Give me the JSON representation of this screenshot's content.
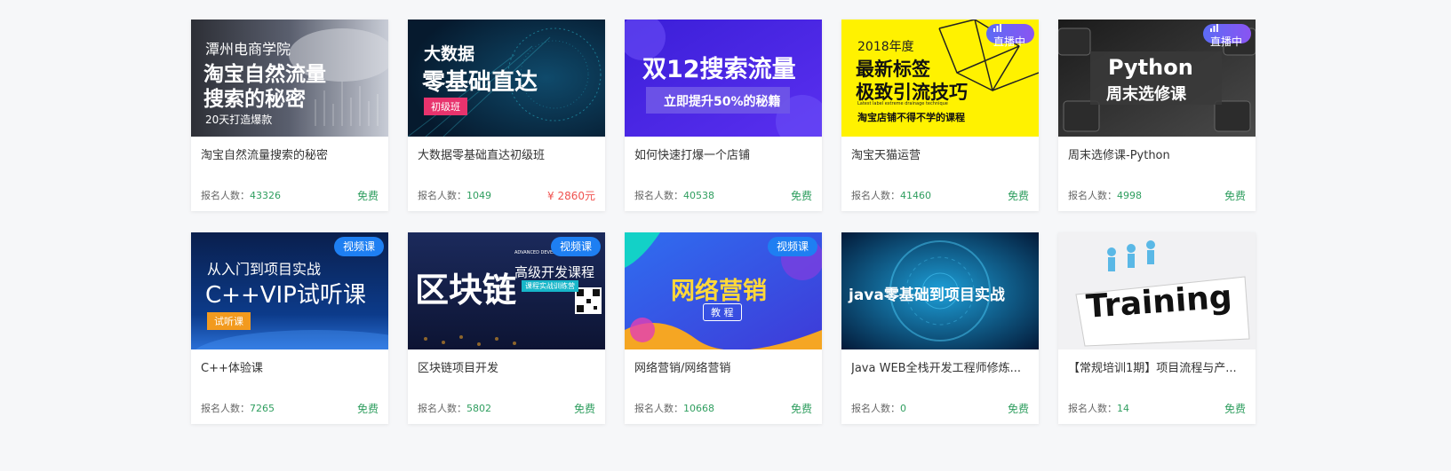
{
  "enroll_label": "报名人数：",
  "colors": {
    "free": "#2f9e5f",
    "paid": "#f0524f",
    "live_badge": "#6b5ff3",
    "video_badge": "#1e7ff2"
  },
  "courses": [
    {
      "title": "淘宝自然流量搜索的秘密",
      "enroll_count": "43326",
      "price": "免费",
      "badge": "",
      "cover_text": [
        "潭州电商学院",
        "淘宝自然流量",
        "搜索的秘密",
        "20天打造爆款"
      ]
    },
    {
      "title": "大数据零基础直达初级班",
      "enroll_count": "1049",
      "price": "¥ 2860元",
      "badge": "",
      "cover_text": [
        "大数据",
        "零基础直达",
        "初级班"
      ]
    },
    {
      "title": "如何快速打爆一个店铺",
      "enroll_count": "40538",
      "price": "免费",
      "badge": "",
      "cover_text": [
        "双12搜索流量",
        "立即提升50%的秘籍"
      ]
    },
    {
      "title": "淘宝天猫运营",
      "enroll_count": "41460",
      "price": "免费",
      "badge": "直播中",
      "cover_text": [
        "2018年度",
        "最新标签",
        "极致引流技巧",
        "Latest label extreme drainage technique",
        "淘宝店铺不得不学的课程"
      ]
    },
    {
      "title": "周末选修课-Python",
      "enroll_count": "4998",
      "price": "免费",
      "badge": "直播中",
      "cover_text": [
        "Python",
        "周末选修课"
      ]
    },
    {
      "title": "C++体验课",
      "enroll_count": "7265",
      "price": "免费",
      "badge": "视频课",
      "cover_text": [
        "从入门到项目实战",
        "C++VIP试听课",
        "试听课"
      ]
    },
    {
      "title": "区块链项目开发",
      "enroll_count": "5802",
      "price": "免费",
      "badge": "视频课",
      "cover_text": [
        "区块链",
        "高级开发课程",
        "ADVANCED DEVELOPMENT COURSE",
        "课程实战训练营"
      ]
    },
    {
      "title": "网络营销/网络营销",
      "enroll_count": "10668",
      "price": "免费",
      "badge": "视频课",
      "cover_text": [
        "网络营销",
        "教 程"
      ]
    },
    {
      "title": "Java WEB全栈开发工程师修炼...",
      "enroll_count": "0",
      "price": "免费",
      "badge": "",
      "cover_text": [
        "java零基础到项目实战"
      ]
    },
    {
      "title": "【常规培训1期】项目流程与产...",
      "enroll_count": "14",
      "price": "免费",
      "badge": "",
      "cover_text": [
        "Training"
      ]
    }
  ]
}
